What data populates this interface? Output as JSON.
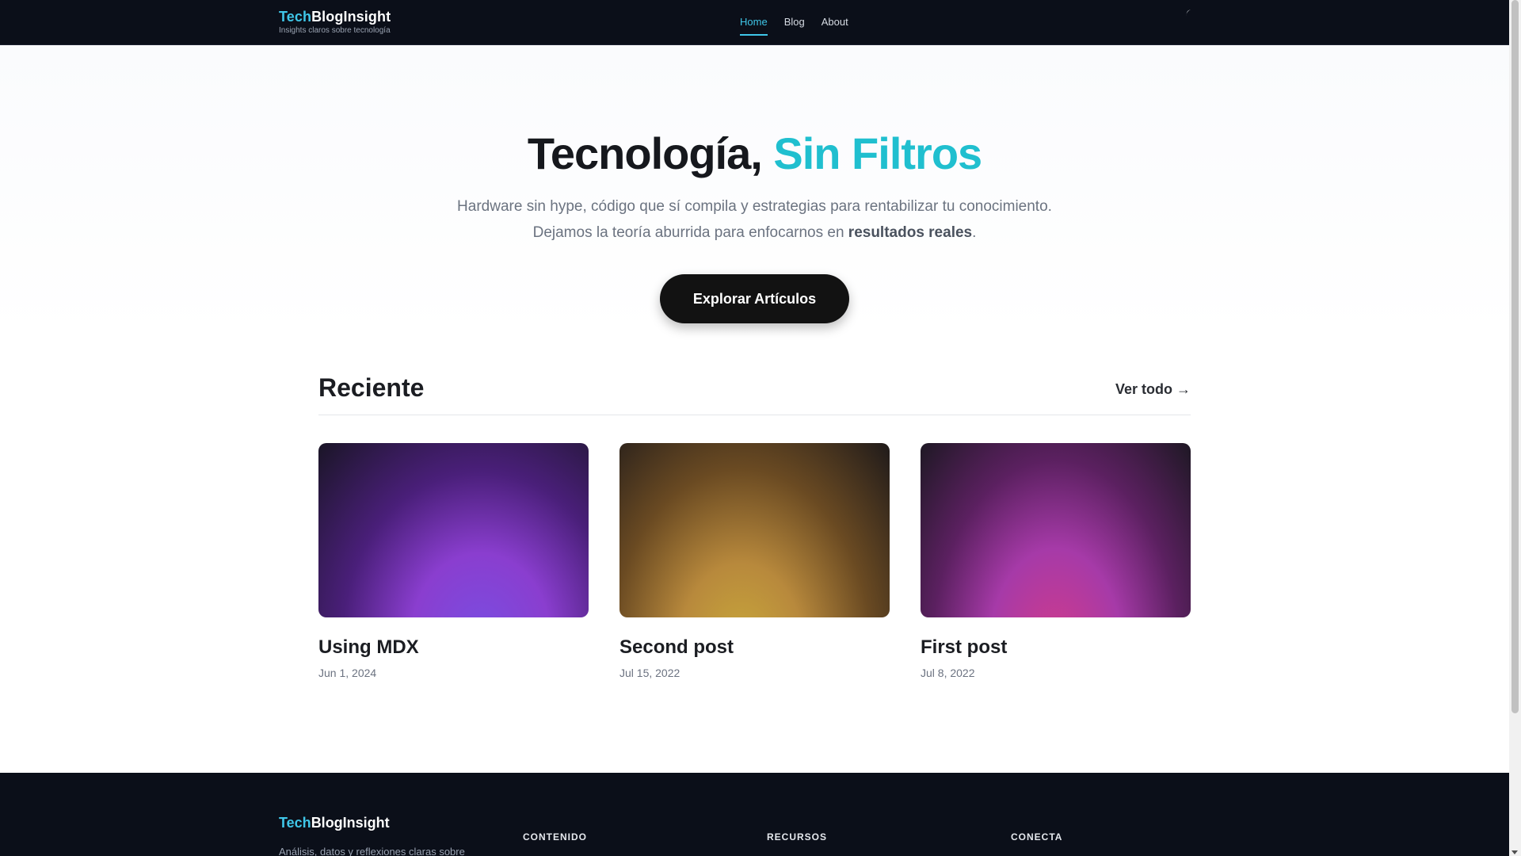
{
  "header": {
    "brand_accent": "Tech",
    "brand_rest": "BlogInsight",
    "tagline": "Insights claros sobre tecnología",
    "nav": [
      {
        "label": "Home",
        "active": true
      },
      {
        "label": "Blog",
        "active": false
      },
      {
        "label": "About",
        "active": false
      }
    ],
    "theme_icon": "moon-icon"
  },
  "hero": {
    "title_main": "Tecnología, ",
    "title_highlight": "Sin Filtros",
    "subtitle_line1": "Hardware sin hype, código que sí compila y estrategias para rentabilizar tu conocimiento.",
    "subtitle_line2_pre": "Dejamos la teoría aburrida para enfocarnos en ",
    "subtitle_line2_bold": "resultados reales",
    "subtitle_line2_post": ".",
    "cta_label": "Explorar Artículos"
  },
  "recent": {
    "title": "Reciente",
    "see_all": "Ver todo →",
    "posts": [
      {
        "title": "Using MDX",
        "date": "Jun 1, 2024"
      },
      {
        "title": "Second post",
        "date": "Jul 15, 2022"
      },
      {
        "title": "First post",
        "date": "Jul 8, 2022"
      }
    ]
  },
  "footer": {
    "brand_accent": "Tech",
    "brand_rest": "BlogInsight",
    "description": "Análisis, datos y reflexiones claras sobre",
    "columns": [
      "CONTENIDO",
      "RECURSOS",
      "CONECTA"
    ]
  },
  "colors": {
    "accent": "#3fc6e8",
    "highlight": "#20bfcf",
    "dark": "#0b0f19"
  }
}
